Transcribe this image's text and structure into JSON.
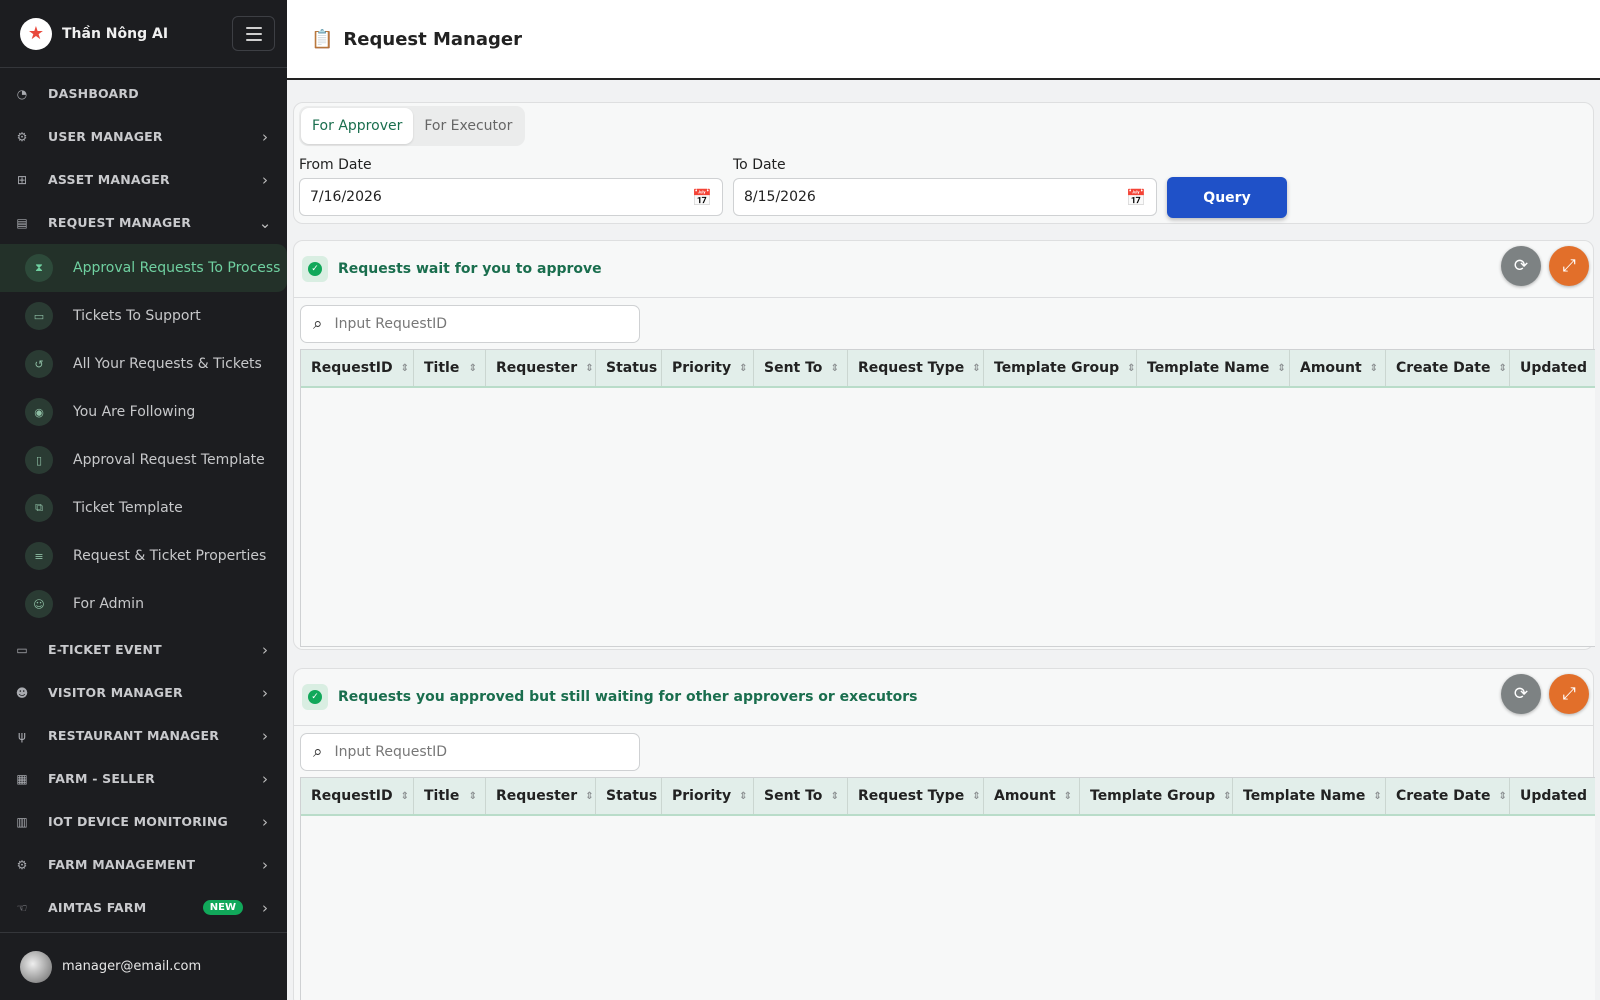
{
  "app": {
    "brand": "Thần Nông AI",
    "page_title": "Request Manager",
    "user_email": "manager@email.com"
  },
  "sidebar": {
    "items_top": [
      {
        "label": "DASHBOARD",
        "icon": "gauge-icon",
        "chevron": ""
      },
      {
        "label": "USER MANAGER",
        "icon": "users-gear-icon",
        "chevron": "›"
      },
      {
        "label": "ASSET MANAGER",
        "icon": "hierarchy-icon",
        "chevron": "›"
      },
      {
        "label": "REQUEST MANAGER",
        "icon": "clipboard-icon",
        "chevron": "⌄"
      }
    ],
    "sub_items": [
      {
        "label": "Approval Requests To Process",
        "icon": "hourglass-icon"
      },
      {
        "label": "Tickets To Support",
        "icon": "ticket-icon"
      },
      {
        "label": "All Your Requests & Tickets",
        "icon": "history-icon"
      },
      {
        "label": "You Are Following",
        "icon": "eye-icon"
      },
      {
        "label": "Approval Request Template",
        "icon": "document-icon"
      },
      {
        "label": "Ticket Template",
        "icon": "copy-icon"
      },
      {
        "label": "Request & Ticket Properties",
        "icon": "sliders-icon"
      },
      {
        "label": "For Admin",
        "icon": "user-shield-icon"
      }
    ],
    "items_bottom": [
      {
        "label": "E-TICKET EVENT",
        "icon": "ticket-icon",
        "chevron": "›"
      },
      {
        "label": "VISITOR MANAGER",
        "icon": "group-icon",
        "chevron": "›"
      },
      {
        "label": "RESTAURANT MANAGER",
        "icon": "utensils-icon",
        "chevron": "›"
      },
      {
        "label": "FARM - SELLER",
        "icon": "store-icon",
        "chevron": "›"
      },
      {
        "label": "IOT DEVICE MONITORING",
        "icon": "factory-icon",
        "chevron": "›"
      },
      {
        "label": "FARM MANAGEMENT",
        "icon": "tractor-icon",
        "chevron": "›"
      },
      {
        "label": "AIMTAS FARM",
        "icon": "hand-icon",
        "chevron": "›",
        "badge": "NEW"
      }
    ]
  },
  "filters": {
    "tabs": [
      "For Approver",
      "For Executor"
    ],
    "active_tab": 0,
    "from_label": "From Date",
    "from_value": "7/16/2026",
    "to_label": "To Date",
    "to_value": "8/15/2026",
    "query_label": "Query"
  },
  "panel1": {
    "title": "Requests wait for you to approve",
    "search_placeholder": "Input RequestID",
    "columns": [
      "RequestID",
      "Title",
      "Requester",
      "Status",
      "Priority",
      "Sent To",
      "Request Type",
      "Template Group",
      "Template Name",
      "Amount",
      "Create Date",
      "Updated"
    ]
  },
  "panel2": {
    "title": "Requests you approved but still waiting for other approvers or executors",
    "search_placeholder": "Input RequestID",
    "columns": [
      "RequestID",
      "Title",
      "Requester",
      "Status",
      "Priority",
      "Sent To",
      "Request Type",
      "Amount",
      "Template Group",
      "Template Name",
      "Create Date",
      "Updated"
    ]
  },
  "colors": {
    "sidebar_bg": "#1c1d20",
    "accent_green": "#1a6e4e",
    "query_blue": "#1f51c8",
    "expand_orange": "#e26f2a"
  }
}
